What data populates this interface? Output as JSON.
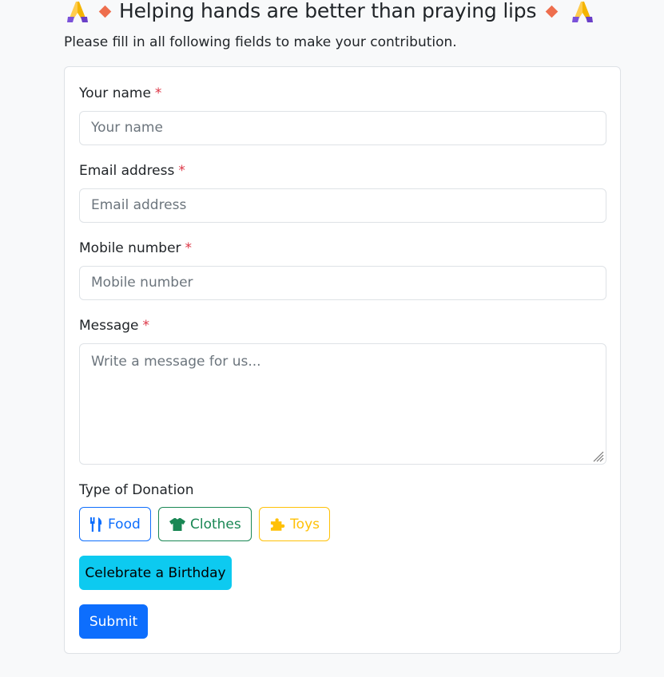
{
  "header": {
    "title": "Helping hands are better than praying lips",
    "subtitle": "Please fill in all following fields to make your contribution."
  },
  "form": {
    "name": {
      "label": "Your name",
      "required_mark": "*",
      "placeholder": "Your name"
    },
    "email": {
      "label": "Email address",
      "required_mark": "*",
      "placeholder": "Email address"
    },
    "mobile": {
      "label": "Mobile number",
      "required_mark": "*",
      "placeholder": "Mobile number"
    },
    "message": {
      "label": "Message",
      "required_mark": "*",
      "placeholder": "Write a message for us..."
    },
    "donation_type": {
      "label": "Type of Donation",
      "options": [
        {
          "label": "Food",
          "icon": "utensils-icon",
          "color": "#0d6efd"
        },
        {
          "label": "Clothes",
          "icon": "tshirt-icon",
          "color": "#198754"
        },
        {
          "label": "Toys",
          "icon": "puzzle-icon",
          "color": "#ffc107"
        }
      ]
    },
    "birthday_button": "Celebrate a Birthday",
    "submit_button": "Submit"
  },
  "colors": {
    "primary": "#0d6efd",
    "info": "#0dcaf0",
    "success": "#198754",
    "warning": "#ffc107",
    "danger": "#dc3545",
    "diamond": "#ee6e4d"
  }
}
